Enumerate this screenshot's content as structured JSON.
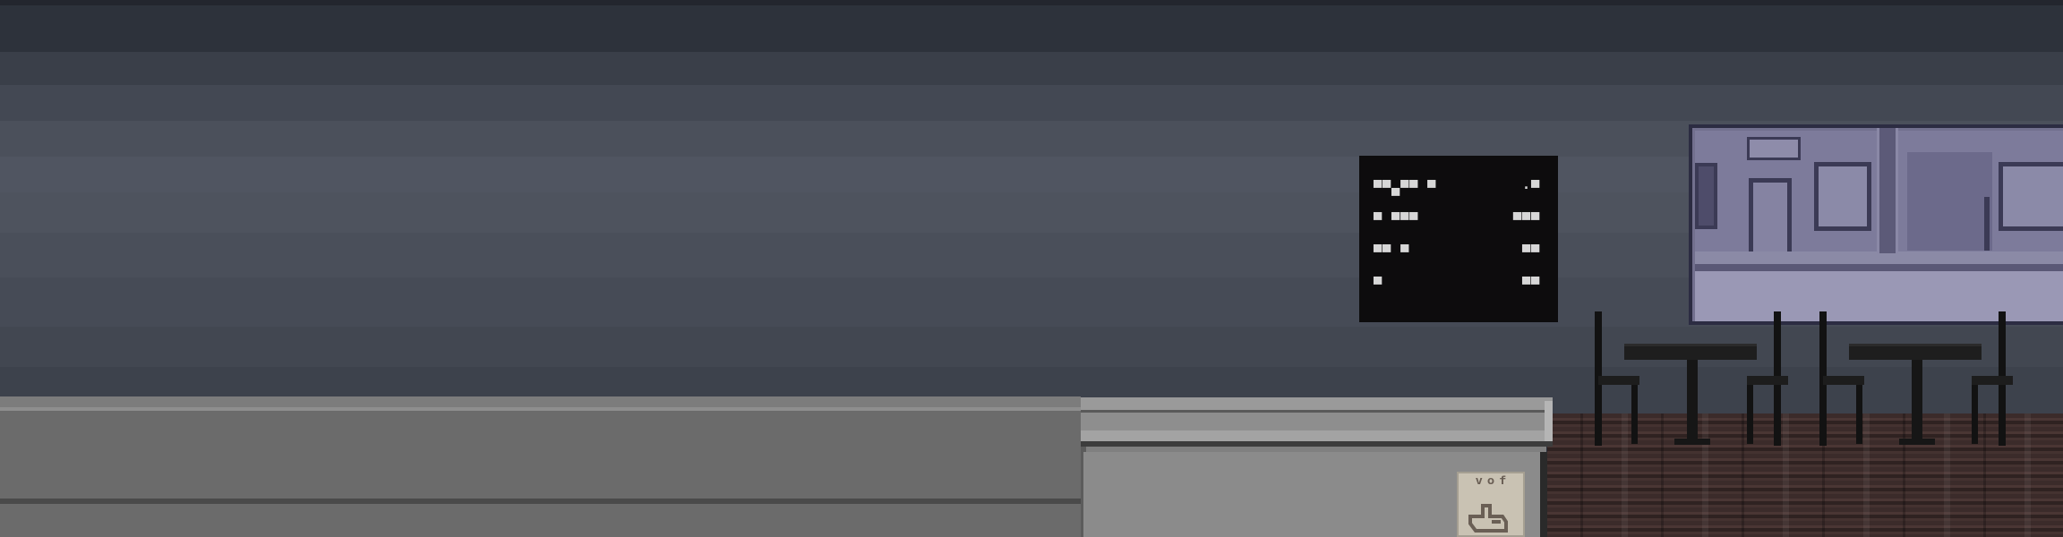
{
  "scene": {
    "type": "pixel-art cafe interior",
    "colors": {
      "wall": "#4b505b",
      "counter": "#6b6b6b",
      "floor": "#3b2b2a",
      "chalkboard": "#0d0c0d",
      "window_tint": "#72708e"
    }
  },
  "menu_board": {
    "rows": [
      {
        "item": "▀▀▄▀▀ ▀",
        "price": "·▀"
      },
      {
        "item": "▀ ▀▀▀",
        "price": "▀▀▀"
      },
      {
        "item": "▀▀ ▀",
        "price": "▀▀"
      },
      {
        "item": "▀",
        "price": "▀▀"
      }
    ]
  },
  "counter_note": {
    "text": "ᵛᵒᶠ",
    "icon": "hand-pointer-icon"
  },
  "furniture": {
    "tables": 2,
    "chairs": 4
  }
}
